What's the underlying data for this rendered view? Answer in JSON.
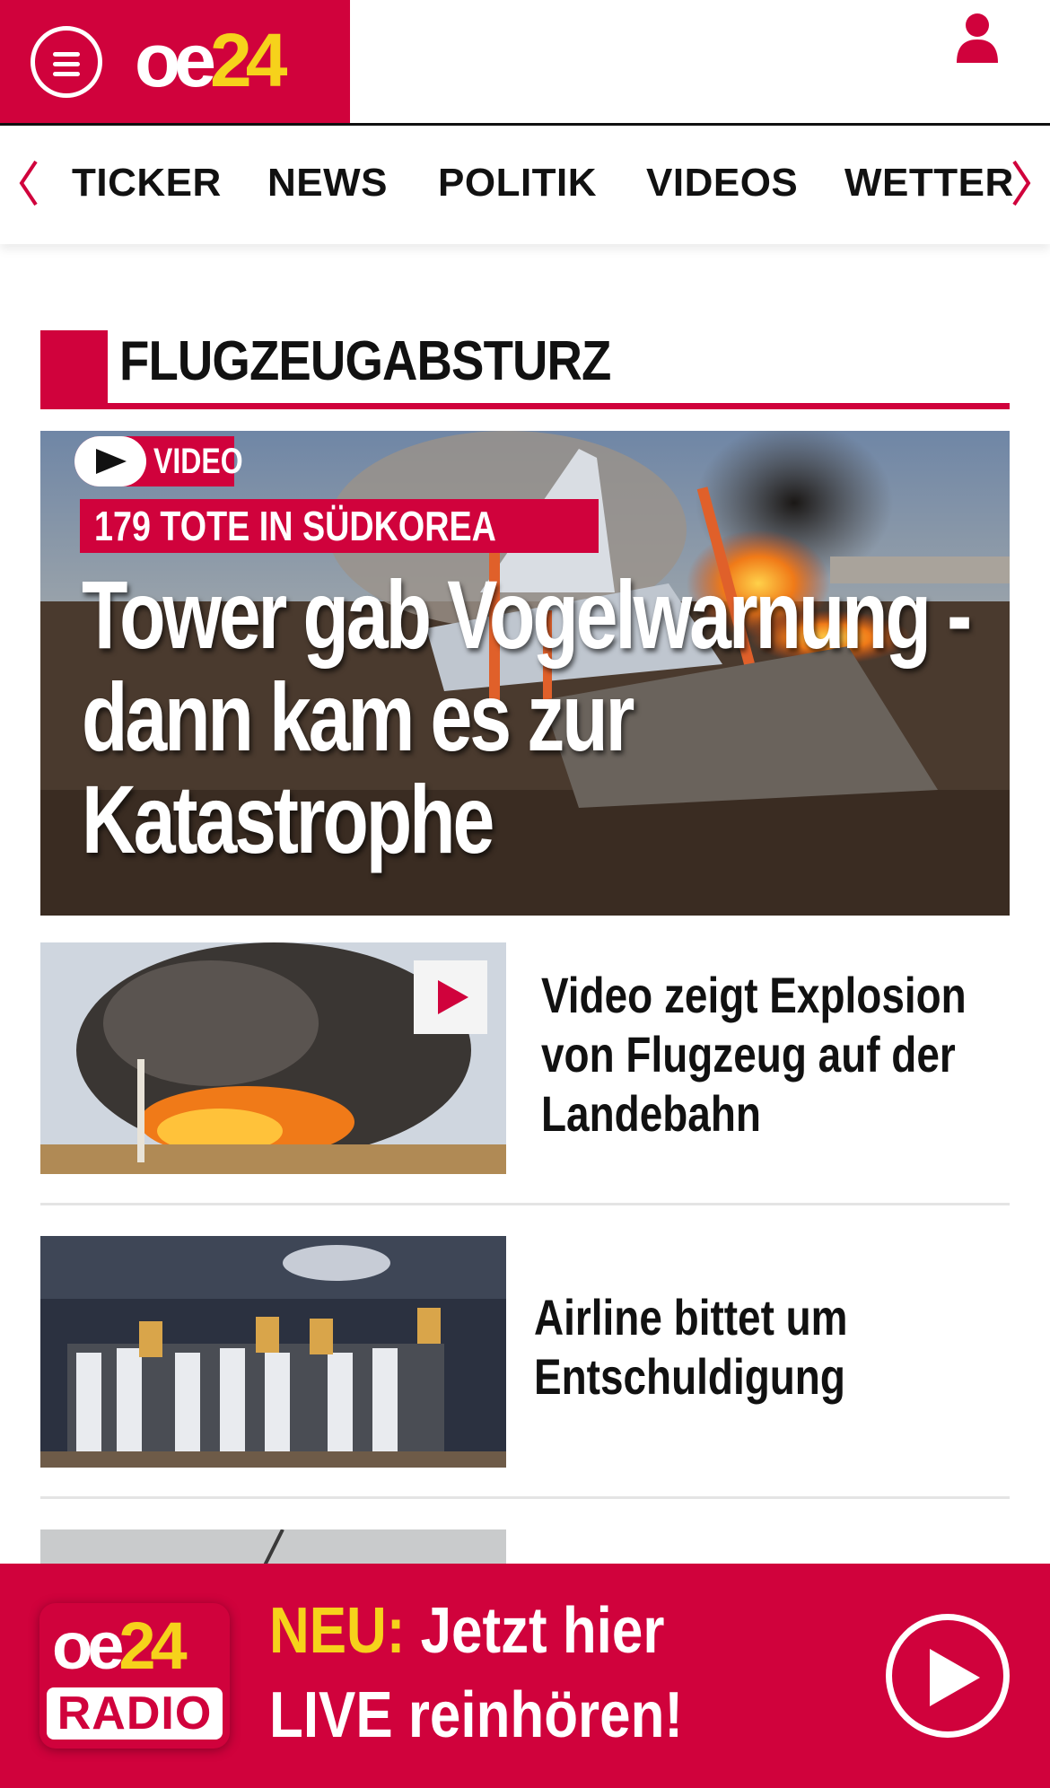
{
  "header": {
    "logo": {
      "oe": "oe",
      "num": "24"
    },
    "menu_icon": "hamburger-menu-icon",
    "user_icon": "user-icon"
  },
  "nav": {
    "items": [
      {
        "label": "TICKER"
      },
      {
        "label": "NEWS"
      },
      {
        "label": "POLITIK"
      },
      {
        "label": "VIDEOS"
      },
      {
        "label": "WETTER"
      }
    ]
  },
  "section": {
    "title": "FLUGZEUGABSTURZ"
  },
  "hero": {
    "badge": "VIDEO",
    "kicker": "179 TOTE IN SÜDKOREA",
    "title": "Tower gab Vogelwarnung - dann kam es zur Katastrophe"
  },
  "stories": [
    {
      "headline": "Video zeigt Explosion von Flugzeug auf der Landebahn",
      "has_video": true
    },
    {
      "headline": "Airline bittet um Entschuldigung",
      "has_video": false
    }
  ],
  "radio_banner": {
    "logo_oe": "oe",
    "logo_num": "24",
    "logo_radio": "RADIO",
    "neu": "NEU:",
    "line1": "Jetzt hier",
    "line2": "LIVE reinhören!"
  },
  "colors": {
    "brand_red": "#d0023c",
    "brand_yellow": "#f6d21b",
    "text": "#111111"
  }
}
